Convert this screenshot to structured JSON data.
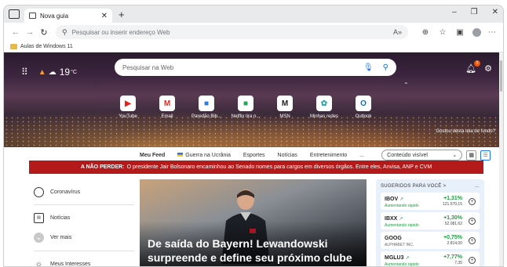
{
  "browser": {
    "tab_title": "Nova guia",
    "address_placeholder": "Pesquisar ou inserir endereço Web",
    "favorites": [
      {
        "label": "Aulas de Windows 11"
      }
    ]
  },
  "hero": {
    "temperature": "19",
    "temp_unit": "°C",
    "search_placeholder": "Pesquisar na Web",
    "notification_count": "5",
    "image_credit": "Gostou desta tela de fundo?",
    "shortcuts": [
      {
        "label": "YouTube",
        "icon": "youtube-icon",
        "glyph": "▶",
        "color": "#e62117"
      },
      {
        "label": "Email",
        "icon": "gmail-icon",
        "glyph": "M",
        "color": "#d93025"
      },
      {
        "label": "Paredão Bib...",
        "icon": "windows-icon",
        "glyph": "■",
        "color": "#2f7be0"
      },
      {
        "label": "Netflix tira n...",
        "icon": "windows-icon",
        "glyph": "■",
        "color": "#26a259"
      },
      {
        "label": "MSN",
        "icon": "msn-icon",
        "glyph": "M",
        "color": "#222222"
      },
      {
        "label": "Minhas redes",
        "icon": "network-icon",
        "glyph": "✿",
        "color": "#2aa6a8"
      },
      {
        "label": "Outlook",
        "icon": "outlook-icon",
        "glyph": "O",
        "color": "#0f6cbd"
      }
    ]
  },
  "feed": {
    "items": [
      "Meu Feed",
      "Guerra na Ucrânia",
      "Esportes",
      "Notícias",
      "Entretenimento"
    ],
    "more": "...",
    "select_value": "Conteúdo visível"
  },
  "alert": {
    "bold": "A NÃO PERDER:",
    "text": "O presidente Jair Bolsonaro encaminhou ao Senado nomes para cargos em diversos órgãos. Entre eles, Anvisa, ANP e CVM"
  },
  "rail": {
    "coronavirus": "Coronavírus",
    "news": "Notícias",
    "more": "Ver mais",
    "interests": "Meus Interesses"
  },
  "story": {
    "headline": "De saída do Bayern! Lewandowski surpreende e define seu próximo clube"
  },
  "stocks": {
    "title": "SUGERIDOS PARA VOCÊ",
    "title_chevron": ">",
    "more": "...",
    "items": [
      {
        "symbol": "IBOV",
        "sub": "Aumentando rápido",
        "change": "+1,31%",
        "price": "121.570,15"
      },
      {
        "symbol": "IBXX",
        "sub": "Aumentando rápido",
        "change": "+1,30%",
        "price": "52.081,62"
      },
      {
        "symbol": "GOOG",
        "sub": "ALPHABET INC.",
        "change": "+0,75%",
        "price": "2.814,00"
      },
      {
        "symbol": "MGLU3",
        "sub": "Aumentando rápido",
        "change": "+7,77%",
        "price": "7,35"
      }
    ]
  }
}
